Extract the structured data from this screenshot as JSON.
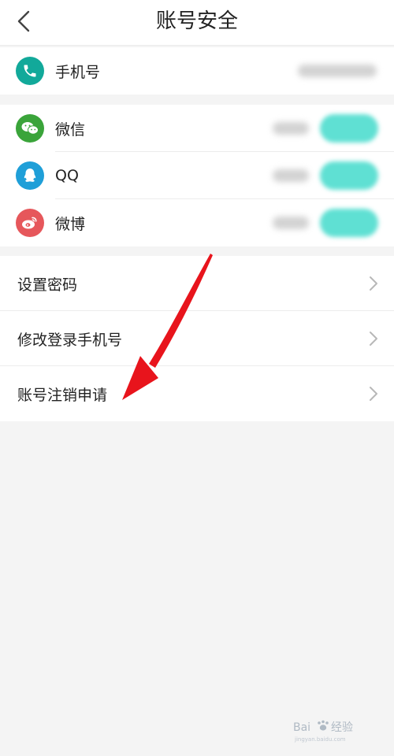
{
  "header": {
    "title": "账号安全",
    "back_icon": "back-arrow-icon"
  },
  "phone": {
    "label": "手机号",
    "icon": "phone-icon",
    "icon_color": "#12a99a"
  },
  "bindings": [
    {
      "label": "微信",
      "icon": "wechat-icon",
      "icon_color": "#3aa43a"
    },
    {
      "label": "QQ",
      "icon": "qq-icon",
      "icon_color": "#1f9fd8"
    },
    {
      "label": "微博",
      "icon": "weibo-icon",
      "icon_color": "#e6575b"
    }
  ],
  "menu": [
    {
      "label": "设置密码"
    },
    {
      "label": "修改登录手机号"
    },
    {
      "label": "账号注销申请"
    }
  ],
  "colors": {
    "arrow": "#e8141c",
    "teal_button": "#5fe0d3",
    "background": "#f4f4f4"
  },
  "watermark": {
    "brand": "Bai",
    "brand2": "经验",
    "sub": "jingyan.baidu.com"
  }
}
